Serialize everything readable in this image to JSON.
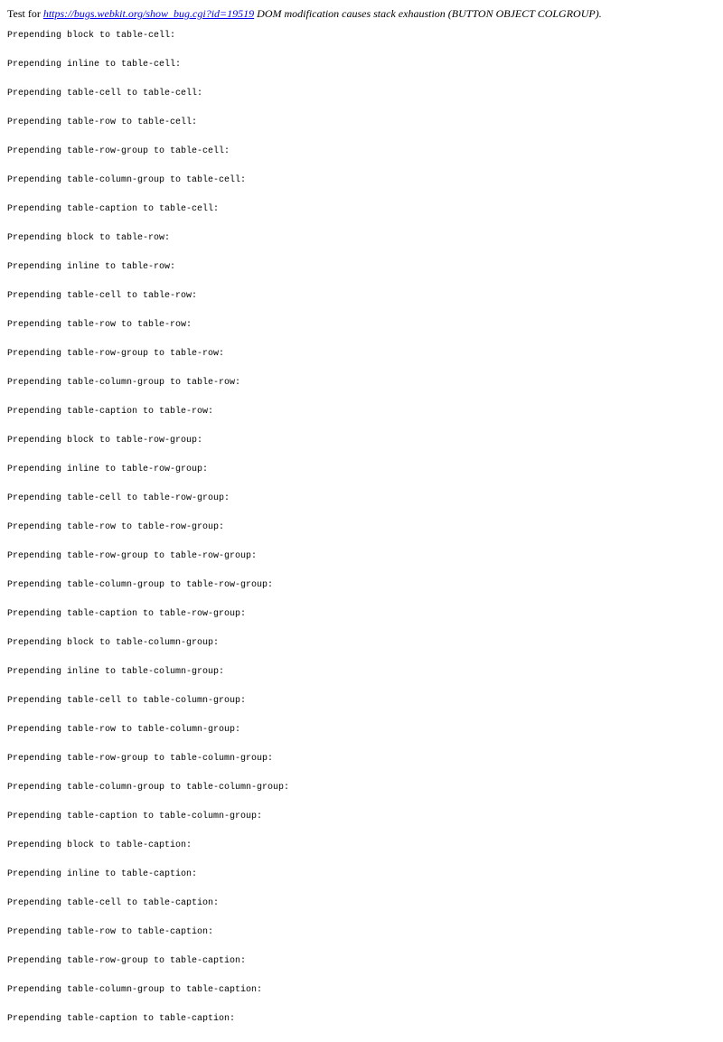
{
  "header": {
    "prefix": "Test for ",
    "link_text": "https://bugs.webkit.org/show_bug.cgi?id=19519",
    "description": " DOM modification causes stack exhaustion (BUTTON OBJECT COLGROUP)."
  },
  "lines": [
    "Prepending block to table-cell:",
    "Prepending inline to table-cell:",
    "Prepending table-cell to table-cell:",
    "Prepending table-row to table-cell:",
    "Prepending table-row-group to table-cell:",
    "Prepending table-column-group to table-cell:",
    "Prepending table-caption to table-cell:",
    "Prepending block to table-row:",
    "Prepending inline to table-row:",
    "Prepending table-cell to table-row:",
    "Prepending table-row to table-row:",
    "Prepending table-row-group to table-row:",
    "Prepending table-column-group to table-row:",
    "Prepending table-caption to table-row:",
    "Prepending block to table-row-group:",
    "Prepending inline to table-row-group:",
    "Prepending table-cell to table-row-group:",
    "Prepending table-row to table-row-group:",
    "Prepending table-row-group to table-row-group:",
    "Prepending table-column-group to table-row-group:",
    "Prepending table-caption to table-row-group:",
    "Prepending block to table-column-group:",
    "Prepending inline to table-column-group:",
    "Prepending table-cell to table-column-group:",
    "Prepending table-row to table-column-group:",
    "Prepending table-row-group to table-column-group:",
    "Prepending table-column-group to table-column-group:",
    "Prepending table-caption to table-column-group:",
    "Prepending block to table-caption:",
    "Prepending inline to table-caption:",
    "Prepending table-cell to table-caption:",
    "Prepending table-row to table-caption:",
    "Prepending table-row-group to table-caption:",
    "Prepending table-column-group to table-caption:",
    "Prepending table-caption to table-caption:"
  ]
}
